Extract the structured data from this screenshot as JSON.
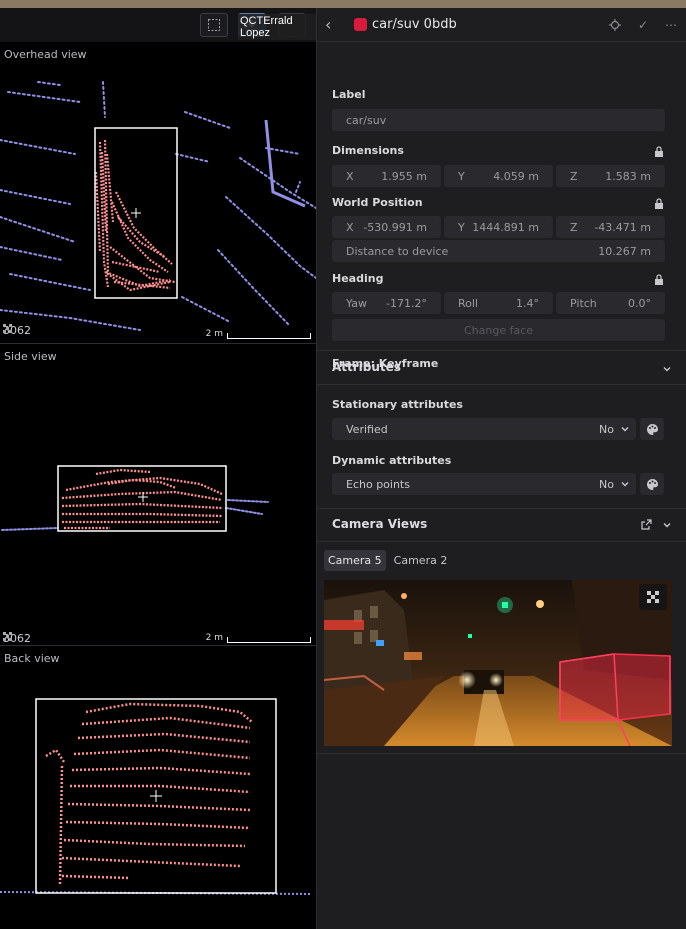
{
  "colors": {
    "accent": "#d81b3c",
    "lidar": "#8f90e6",
    "points": "#ff8f8f"
  },
  "toolbar": {
    "user_name": "QCTErrald Lopez"
  },
  "views": [
    {
      "title": "Overhead view",
      "point_count": "3062",
      "scale": "2 m"
    },
    {
      "title": "Side view",
      "point_count": "3062",
      "scale": "2 m"
    },
    {
      "title": "Back view"
    }
  ],
  "object": {
    "name": "car/suv 0bdb",
    "color": "#d81b3c"
  },
  "label": {
    "title": "Label",
    "value": "car/suv"
  },
  "dimensions": {
    "title": "Dimensions",
    "x": "1.955 m",
    "y": "4.059 m",
    "z": "1.583 m"
  },
  "world_position": {
    "title": "World Position",
    "x": "-530.991 m",
    "y": "1444.891 m",
    "z": "-43.471 m",
    "distance_label": "Distance to device",
    "distance": "10.267 m"
  },
  "heading": {
    "title": "Heading",
    "yaw_label": "Yaw",
    "yaw": "-171.2°",
    "roll_label": "Roll",
    "roll": "1.4°",
    "pitch_label": "Pitch",
    "pitch": "0.0°",
    "change_face": "Change face"
  },
  "frame": "Frame: Keyframe",
  "attributes": {
    "title": "Attributes",
    "stationary_title": "Stationary attributes",
    "verified_label": "Verified",
    "verified_value": "No",
    "dynamic_title": "Dynamic attributes",
    "echo_label": "Echo points",
    "echo_value": "No"
  },
  "camera_views": {
    "title": "Camera Views",
    "tabs": [
      "Camera 5",
      "Camera 2"
    ],
    "selected": "Camera 5"
  }
}
